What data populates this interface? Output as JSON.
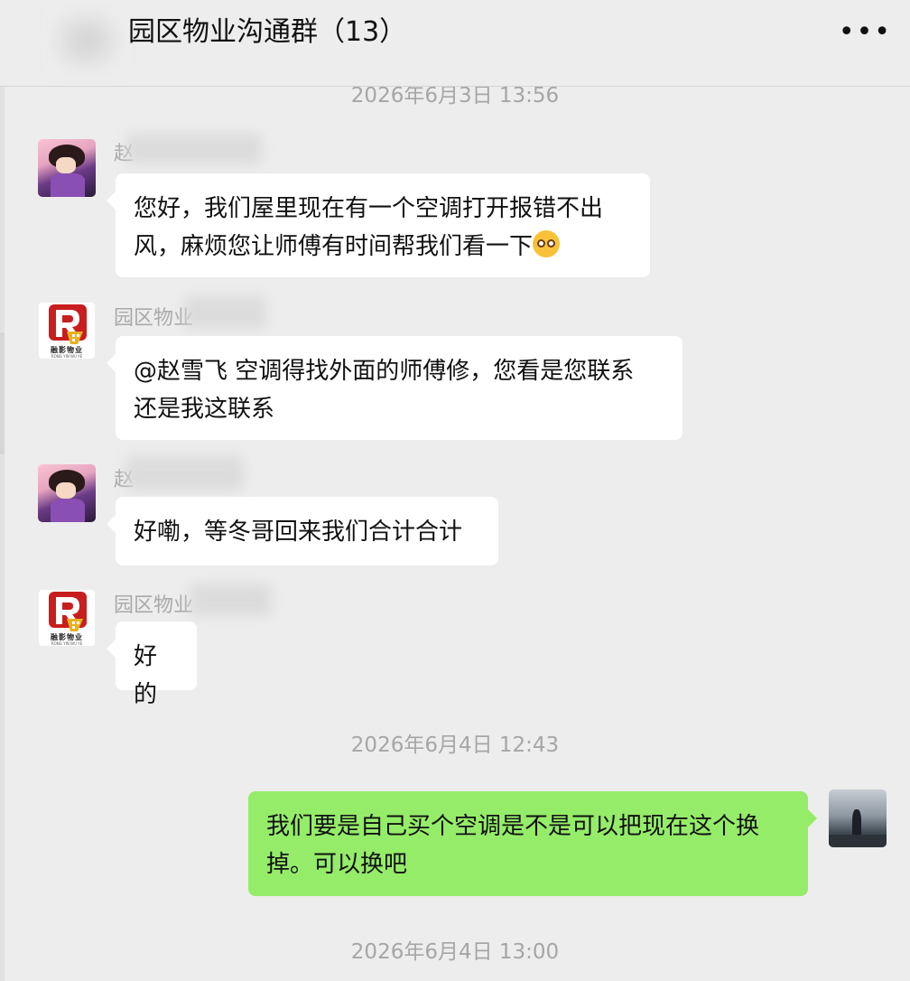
{
  "header": {
    "title": "园区物业沟通群（13）",
    "more_label": "•••"
  },
  "timestamps": {
    "top_cut": "2026年6月3日 13:56",
    "second": "2026年6月4日 12:43",
    "third": "2026年6月4日 13:00"
  },
  "messages": [
    {
      "sender": "赵",
      "text_line1": "您好，我们屋里现在有一个空调打开报错不出",
      "text_line2": "风，麻烦您让师傅有时间帮我们看一下",
      "emoji": "pleading-face-emoji"
    },
    {
      "sender": "园区物业",
      "text_line1": "@赵雪飞 空调得找外面的师傅修，您看是您联系",
      "text_line2": "还是我这联系",
      "logo_text": "融影物业",
      "logo_sub": "RONG YIN WU YE"
    },
    {
      "sender": "赵",
      "text_line1": "好嘞，等冬哥回来我们合计合计"
    },
    {
      "sender": "园区物业",
      "text_line1": "好的",
      "logo_text": "融影物业",
      "logo_sub": "RONG YIN WU YE"
    },
    {
      "sender": "",
      "text_line1": "我们要是自己买个空调是不是可以把现在这个换",
      "text_line2": "掉。可以换吧"
    }
  ],
  "colors": {
    "background": "#ededed",
    "bubble_in": "#ffffff",
    "bubble_out": "#95ec69",
    "logo_red": "#c81e1e",
    "logo_gold": "#e8b21e"
  }
}
